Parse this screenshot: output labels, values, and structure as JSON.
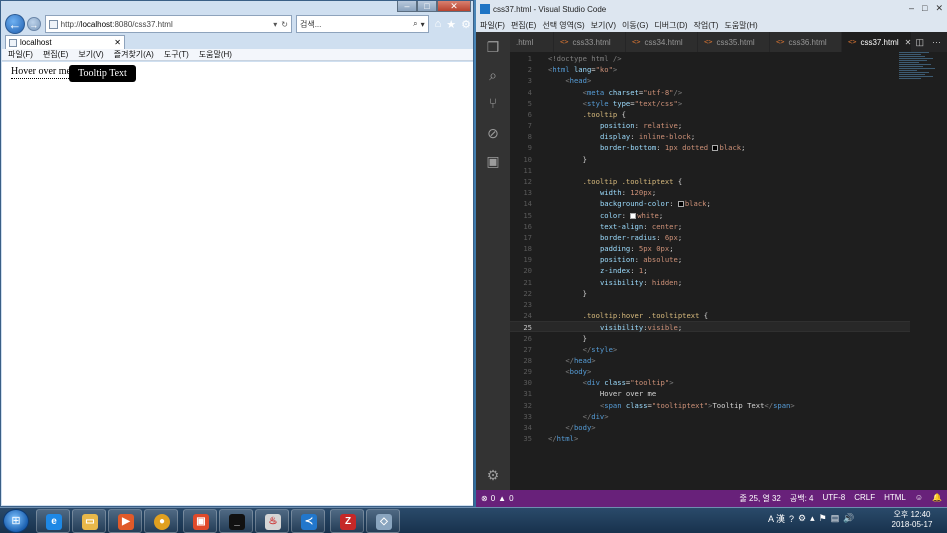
{
  "ie": {
    "url_prefix": "http://",
    "url_host": "localhost",
    "url_rest": ":8080/css37.html",
    "search_placeholder": "검색...",
    "tab_title": "localhost",
    "menu": [
      "파일(F)",
      "편집(E)",
      "보기(V)",
      "즐겨찾기(A)",
      "도구(T)",
      "도움말(H)"
    ],
    "content": {
      "hover_text": "Hover over me",
      "tooltip_text": "Tooltip Text"
    }
  },
  "vscode": {
    "title": "css37.html - Visual Studio Code",
    "menu": [
      "파일(F)",
      "편집(E)",
      "선택 영역(S)",
      "보기(V)",
      "이동(G)",
      "디버그(D)",
      "작업(T)",
      "도움말(H)"
    ],
    "tabs": [
      {
        "label": ".html",
        "active": false
      },
      {
        "label": "css33.html",
        "active": false
      },
      {
        "label": "css34.html",
        "active": false
      },
      {
        "label": "css35.html",
        "active": false
      },
      {
        "label": "css36.html",
        "active": false
      },
      {
        "label": "css37.html",
        "active": true
      }
    ],
    "current_line": 25,
    "code_lines": [
      [
        [
          "pu",
          "<!doctype html />"
        ]
      ],
      [
        [
          "pu",
          "<"
        ],
        [
          "tg",
          "html "
        ],
        [
          "at",
          "lang"
        ],
        [
          "tx",
          "="
        ],
        [
          "st",
          "\"ko\""
        ],
        [
          "pu",
          ">"
        ]
      ],
      [
        [
          "tx",
          "    "
        ],
        [
          "pu",
          "<"
        ],
        [
          "tg",
          "head"
        ],
        [
          "pu",
          ">"
        ]
      ],
      [
        [
          "tx",
          "        "
        ],
        [
          "pu",
          "<"
        ],
        [
          "tg",
          "meta "
        ],
        [
          "at",
          "charset"
        ],
        [
          "tx",
          "="
        ],
        [
          "st",
          "\"utf-8\""
        ],
        [
          "pu",
          "/>"
        ]
      ],
      [
        [
          "tx",
          "        "
        ],
        [
          "pu",
          "<"
        ],
        [
          "tg",
          "style "
        ],
        [
          "at",
          "type"
        ],
        [
          "tx",
          "="
        ],
        [
          "st",
          "\"text/css\""
        ],
        [
          "pu",
          ">"
        ]
      ],
      [
        [
          "tx",
          "        "
        ],
        [
          "sel",
          ".tooltip "
        ],
        [
          "tx",
          "{"
        ]
      ],
      [
        [
          "tx",
          "            "
        ],
        [
          "pr",
          "position"
        ],
        [
          "tx",
          ": "
        ],
        [
          "vl",
          "relative"
        ],
        [
          "tx",
          ";"
        ]
      ],
      [
        [
          "tx",
          "            "
        ],
        [
          "pr",
          "display"
        ],
        [
          "tx",
          ": "
        ],
        [
          "vl",
          "inline-block"
        ],
        [
          "tx",
          ";"
        ]
      ],
      [
        [
          "tx",
          "            "
        ],
        [
          "pr",
          "border-bottom"
        ],
        [
          "tx",
          ": "
        ],
        [
          "vl",
          "1px dotted "
        ],
        [
          "sw:black",
          ""
        ],
        [
          "vl",
          "black"
        ],
        [
          "tx",
          ";"
        ]
      ],
      [
        [
          "tx",
          "        }"
        ]
      ],
      [
        [
          "tx",
          ""
        ]
      ],
      [
        [
          "tx",
          "        "
        ],
        [
          "sel",
          ".tooltip .tooltiptext "
        ],
        [
          "tx",
          "{"
        ]
      ],
      [
        [
          "tx",
          "            "
        ],
        [
          "pr",
          "width"
        ],
        [
          "tx",
          ": "
        ],
        [
          "vl",
          "120px"
        ],
        [
          "tx",
          ";"
        ]
      ],
      [
        [
          "tx",
          "            "
        ],
        [
          "pr",
          "background-color"
        ],
        [
          "tx",
          ": "
        ],
        [
          "sw:black",
          ""
        ],
        [
          "vl",
          "black"
        ],
        [
          "tx",
          ";"
        ]
      ],
      [
        [
          "tx",
          "            "
        ],
        [
          "pr",
          "color"
        ],
        [
          "tx",
          ": "
        ],
        [
          "sw:white",
          ""
        ],
        [
          "vl",
          "white"
        ],
        [
          "tx",
          ";"
        ]
      ],
      [
        [
          "tx",
          "            "
        ],
        [
          "pr",
          "text-align"
        ],
        [
          "tx",
          ": "
        ],
        [
          "vl",
          "center"
        ],
        [
          "tx",
          ";"
        ]
      ],
      [
        [
          "tx",
          "            "
        ],
        [
          "pr",
          "border-radius"
        ],
        [
          "tx",
          ": "
        ],
        [
          "vl",
          "6px"
        ],
        [
          "tx",
          ";"
        ]
      ],
      [
        [
          "tx",
          "            "
        ],
        [
          "pr",
          "padding"
        ],
        [
          "tx",
          ": "
        ],
        [
          "vl",
          "5px 0px"
        ],
        [
          "tx",
          ";"
        ]
      ],
      [
        [
          "tx",
          "            "
        ],
        [
          "pr",
          "position"
        ],
        [
          "tx",
          ": "
        ],
        [
          "vl",
          "absolute"
        ],
        [
          "tx",
          ";"
        ]
      ],
      [
        [
          "tx",
          "            "
        ],
        [
          "pr",
          "z-index"
        ],
        [
          "tx",
          ": "
        ],
        [
          "vl",
          "1"
        ],
        [
          "tx",
          ";"
        ]
      ],
      [
        [
          "tx",
          "            "
        ],
        [
          "pr",
          "visibility"
        ],
        [
          "tx",
          ": "
        ],
        [
          "vl",
          "hidden"
        ],
        [
          "tx",
          ";"
        ]
      ],
      [
        [
          "tx",
          "        }"
        ]
      ],
      [
        [
          "tx",
          ""
        ]
      ],
      [
        [
          "tx",
          "        "
        ],
        [
          "sel",
          ".tooltip:hover .tooltiptext "
        ],
        [
          "tx",
          "{"
        ]
      ],
      [
        [
          "tx",
          "            "
        ],
        [
          "pr",
          "visibility"
        ],
        [
          "tx",
          ":"
        ],
        [
          "vl",
          "visible"
        ],
        [
          "tx",
          ";"
        ]
      ],
      [
        [
          "tx",
          "        }"
        ]
      ],
      [
        [
          "tx",
          "        "
        ],
        [
          "pu",
          "</"
        ],
        [
          "tg",
          "style"
        ],
        [
          "pu",
          ">"
        ]
      ],
      [
        [
          "tx",
          "    "
        ],
        [
          "pu",
          "</"
        ],
        [
          "tg",
          "head"
        ],
        [
          "pu",
          ">"
        ]
      ],
      [
        [
          "tx",
          "    "
        ],
        [
          "pu",
          "<"
        ],
        [
          "tg",
          "body"
        ],
        [
          "pu",
          ">"
        ]
      ],
      [
        [
          "tx",
          "        "
        ],
        [
          "pu",
          "<"
        ],
        [
          "tg",
          "div "
        ],
        [
          "at",
          "class"
        ],
        [
          "tx",
          "="
        ],
        [
          "st",
          "\"tooltip\""
        ],
        [
          "pu",
          ">"
        ]
      ],
      [
        [
          "tx",
          "            Hover over me"
        ]
      ],
      [
        [
          "tx",
          "            "
        ],
        [
          "pu",
          "<"
        ],
        [
          "tg",
          "span "
        ],
        [
          "at",
          "class"
        ],
        [
          "tx",
          "="
        ],
        [
          "st",
          "\"tooltiptext\""
        ],
        [
          "pu",
          ">"
        ],
        [
          "tx",
          "Tooltip Text"
        ],
        [
          "pu",
          "</"
        ],
        [
          "tg",
          "span"
        ],
        [
          "pu",
          ">"
        ]
      ],
      [
        [
          "tx",
          "        "
        ],
        [
          "pu",
          "</"
        ],
        [
          "tg",
          "div"
        ],
        [
          "pu",
          ">"
        ]
      ],
      [
        [
          "tx",
          "    "
        ],
        [
          "pu",
          "</"
        ],
        [
          "tg",
          "body"
        ],
        [
          "pu",
          ">"
        ]
      ],
      [
        [
          "pu",
          "</"
        ],
        [
          "tg",
          "html"
        ],
        [
          "pu",
          ">"
        ]
      ]
    ],
    "status": {
      "errors": "0",
      "warnings": "0",
      "position": "줄 25, 열 32",
      "spaces": "공백: 4",
      "encoding": "UTF-8",
      "eol": "CRLF",
      "language": "HTML"
    }
  },
  "taskbar": {
    "clock_time": "오후 12:40",
    "clock_date": "2018-05-17",
    "tray_lang": "A 漢"
  }
}
